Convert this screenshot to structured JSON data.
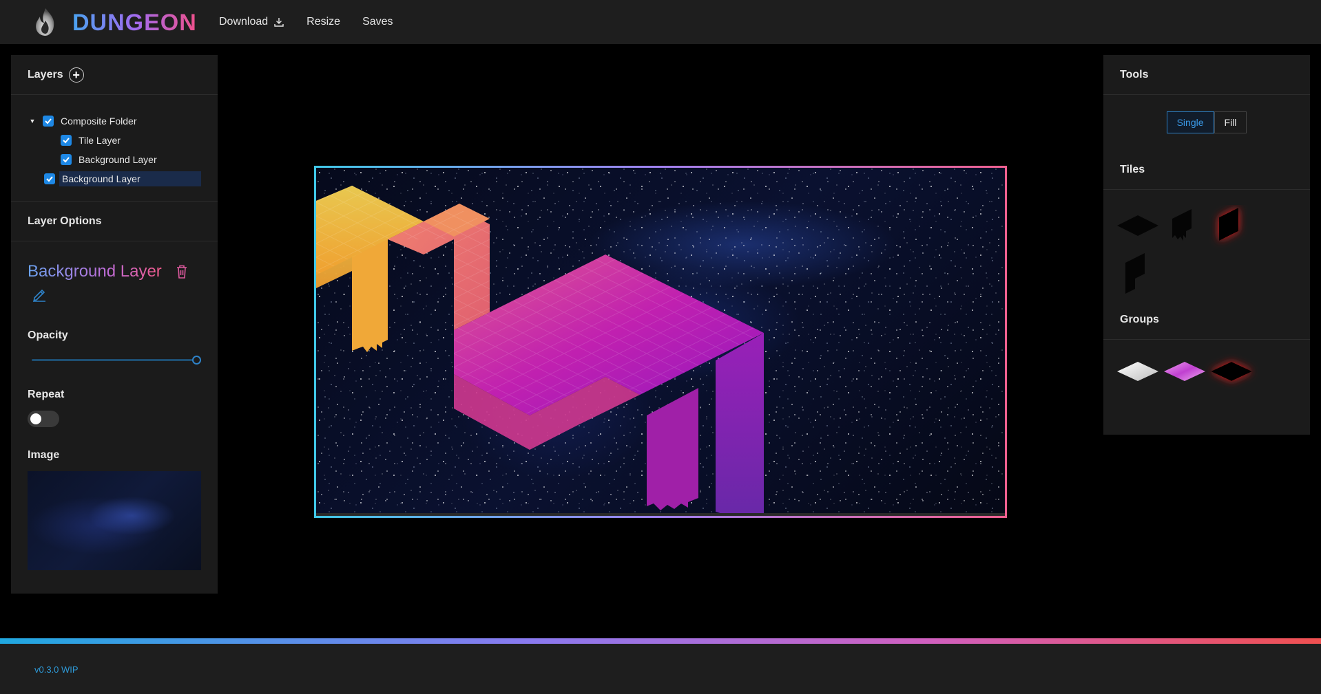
{
  "app": {
    "brand": "DUNGEON",
    "nav": [
      {
        "label": "Download",
        "icon": "download-icon"
      },
      {
        "label": "Resize"
      },
      {
        "label": "Saves"
      }
    ]
  },
  "layers_panel": {
    "title": "Layers",
    "add_icon": "plus-icon",
    "tree": [
      {
        "label": "Composite Folder",
        "checked": true,
        "expanded": true,
        "depth": 0
      },
      {
        "label": "Tile Layer",
        "checked": true,
        "depth": 1
      },
      {
        "label": "Background Layer",
        "checked": true,
        "depth": 1
      },
      {
        "label": "Background Layer",
        "checked": true,
        "depth": 0,
        "selected": true
      }
    ]
  },
  "layer_options": {
    "title": "Layer Options",
    "layer_name": "Background Layer",
    "opacity_label": "Opacity",
    "opacity_value": 1.0,
    "repeat_label": "Repeat",
    "repeat_on": false,
    "image_label": "Image"
  },
  "tools_panel": {
    "title": "Tools",
    "modes": [
      {
        "label": "Single",
        "active": true
      },
      {
        "label": "Fill",
        "active": false
      }
    ],
    "tiles_title": "Tiles",
    "groups_title": "Groups"
  },
  "footer": {
    "version": "v0.3.0 WIP"
  },
  "colors": {
    "accent": "#1e88e5",
    "gradient_start": "#20a8e0",
    "gradient_mid": "#a080f0",
    "gradient_end": "#f05050"
  }
}
